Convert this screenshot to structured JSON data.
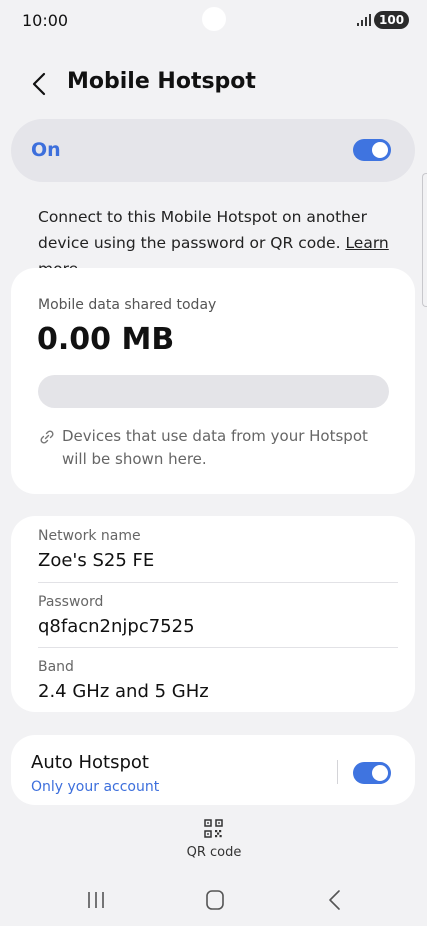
{
  "status_bar": {
    "time": "10:00",
    "battery": "100"
  },
  "header": {
    "title": "Mobile Hotspot"
  },
  "master_switch": {
    "label": "On",
    "enabled": true
  },
  "description": {
    "text": "Connect to this Mobile Hotspot on another device using the password or QR code.",
    "link": "Learn more"
  },
  "usage": {
    "label": "Mobile data shared today",
    "value": "0.00 MB",
    "progress_fraction": 0,
    "note": "Devices that use data from your Hotspot will be shown here."
  },
  "network": {
    "name_label": "Network name",
    "name_value": "Zoe's S25 FE",
    "password_label": "Password",
    "password_value": "q8facn2njpc7525",
    "band_label": "Band",
    "band_value": "2.4 GHz and 5 GHz"
  },
  "auto_hotspot": {
    "title": "Auto Hotspot",
    "subtitle": "Only your account",
    "enabled": true
  },
  "qr": {
    "label": "QR code"
  },
  "colors": {
    "accent": "#3f74e0",
    "background": "#f2f2f4",
    "card": "#ffffff"
  }
}
